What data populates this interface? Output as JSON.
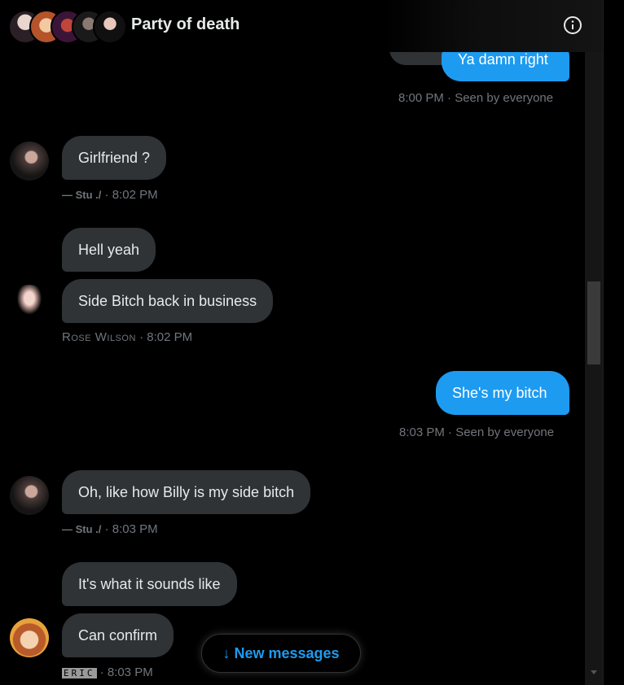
{
  "header": {
    "title": "Party of death",
    "info_icon": "info-circle-icon"
  },
  "messages": {
    "m1": {
      "text": "Ya damn right",
      "meta": "8:00 PM · Seen by everyone"
    },
    "m2": {
      "text": "Girlfriend ?",
      "sender": "— Stu ./",
      "time": " · 8:02 PM"
    },
    "m3": {
      "text": "Hell yeah"
    },
    "m4": {
      "text": "Side Bitch back in business",
      "sender": "Rose Wilson",
      "time": " · 8:02 PM"
    },
    "m5": {
      "text": "She's my bitch",
      "meta": "8:03 PM · Seen by everyone"
    },
    "m6": {
      "text": "Oh, like how Billy is my side bitch",
      "sender": "— Stu ./",
      "time": " · 8:03 PM"
    },
    "m7": {
      "text": "It's what it sounds like"
    },
    "m8": {
      "text": "Can confirm",
      "sender": "ERIC",
      "time": " · 8:03 PM"
    }
  },
  "new_messages_label": "↓ New messages",
  "colors": {
    "outgoing": "#1d9bf0",
    "incoming": "#2f3336",
    "meta": "#71767b",
    "background": "#000000"
  }
}
